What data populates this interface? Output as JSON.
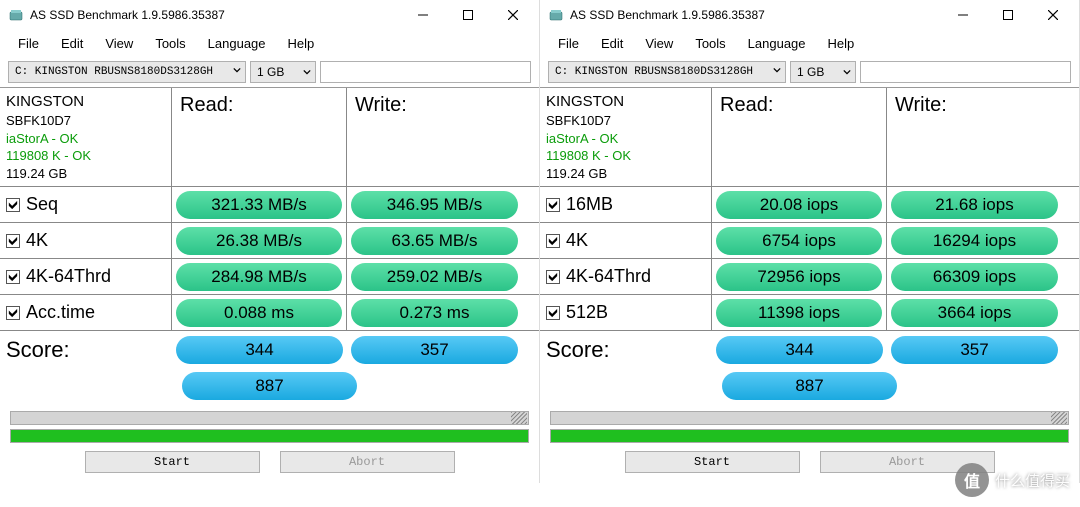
{
  "app": {
    "title": "AS SSD Benchmark 1.9.5986.35387",
    "menu": [
      "File",
      "Edit",
      "View",
      "Tools",
      "Language",
      "Help"
    ],
    "drive_text": "C: KINGSTON RBUSNS8180DS3128GH",
    "size_text": "1 GB",
    "buttons": {
      "start": "Start",
      "abort": "Abort"
    }
  },
  "info": {
    "name": "KINGSTON",
    "fw": "SBFK10D7",
    "controller": "iaStorA - OK",
    "align": "119808 K - OK",
    "capacity": "119.24 GB"
  },
  "headers": {
    "read": "Read:",
    "write": "Write:",
    "score": "Score:"
  },
  "windows": [
    {
      "rows": [
        {
          "label": "Seq",
          "read": "321.33 MB/s",
          "write": "346.95 MB/s"
        },
        {
          "label": "4K",
          "read": "26.38 MB/s",
          "write": "63.65 MB/s"
        },
        {
          "label": "4K-64Thrd",
          "read": "284.98 MB/s",
          "write": "259.02 MB/s"
        },
        {
          "label": "Acc.time",
          "read": "0.088 ms",
          "write": "0.273 ms"
        }
      ],
      "score": {
        "read": "344",
        "write": "357",
        "total": "887"
      }
    },
    {
      "rows": [
        {
          "label": "16MB",
          "read": "20.08 iops",
          "write": "21.68 iops"
        },
        {
          "label": "4K",
          "read": "6754 iops",
          "write": "16294 iops"
        },
        {
          "label": "4K-64Thrd",
          "read": "72956 iops",
          "write": "66309 iops"
        },
        {
          "label": "512B",
          "read": "11398 iops",
          "write": "3664 iops"
        }
      ],
      "score": {
        "read": "344",
        "write": "357",
        "total": "887"
      }
    }
  ],
  "watermark": {
    "badge": "值",
    "text": "什么值得买"
  }
}
